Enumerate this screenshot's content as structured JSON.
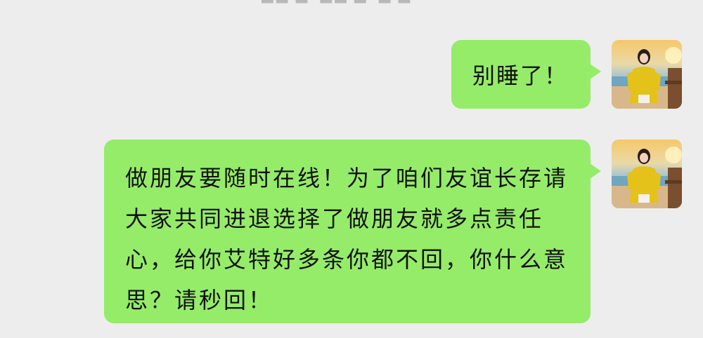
{
  "messages": [
    {
      "sender": "self",
      "text": "别睡了！"
    },
    {
      "sender": "self",
      "text": "做朋友要随时在线！为了咱们友谊长存请大家共同进退选择了做朋友就多点责任心，给你艾特好多条你都不回，你什么意思？请秒回！"
    }
  ],
  "colors": {
    "background": "#ededed",
    "bubble": "#95ec69",
    "text": "#111111"
  },
  "avatar": {
    "icon": "user-photo-avatar"
  }
}
